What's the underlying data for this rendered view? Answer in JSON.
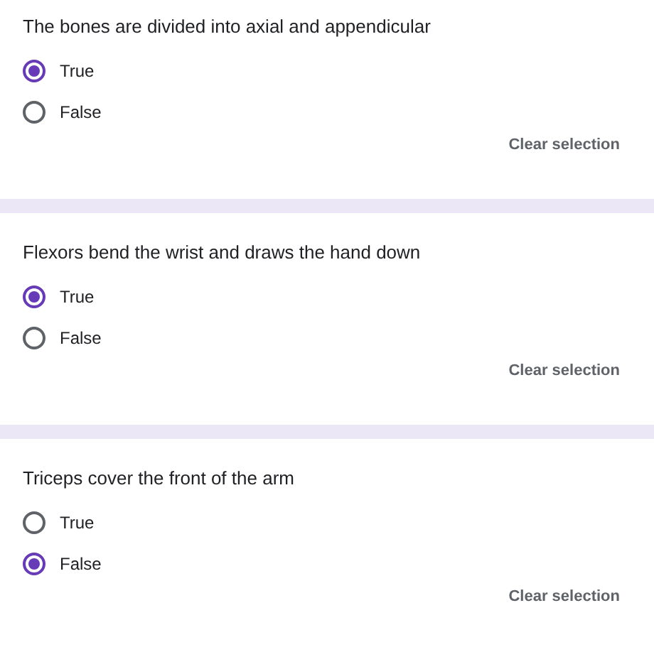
{
  "questions": [
    {
      "title": "The bones are divided into axial and appendicular",
      "options": [
        {
          "label": "True",
          "selected": true
        },
        {
          "label": "False",
          "selected": false
        }
      ],
      "clear": "Clear selection"
    },
    {
      "title": "Flexors bend the wrist and draws the hand down",
      "options": [
        {
          "label": "True",
          "selected": true
        },
        {
          "label": "False",
          "selected": false
        }
      ],
      "clear": "Clear selection"
    },
    {
      "title": "Triceps cover the front of the arm",
      "options": [
        {
          "label": "True",
          "selected": false
        },
        {
          "label": "False",
          "selected": true
        }
      ],
      "clear": "Clear selection"
    }
  ]
}
